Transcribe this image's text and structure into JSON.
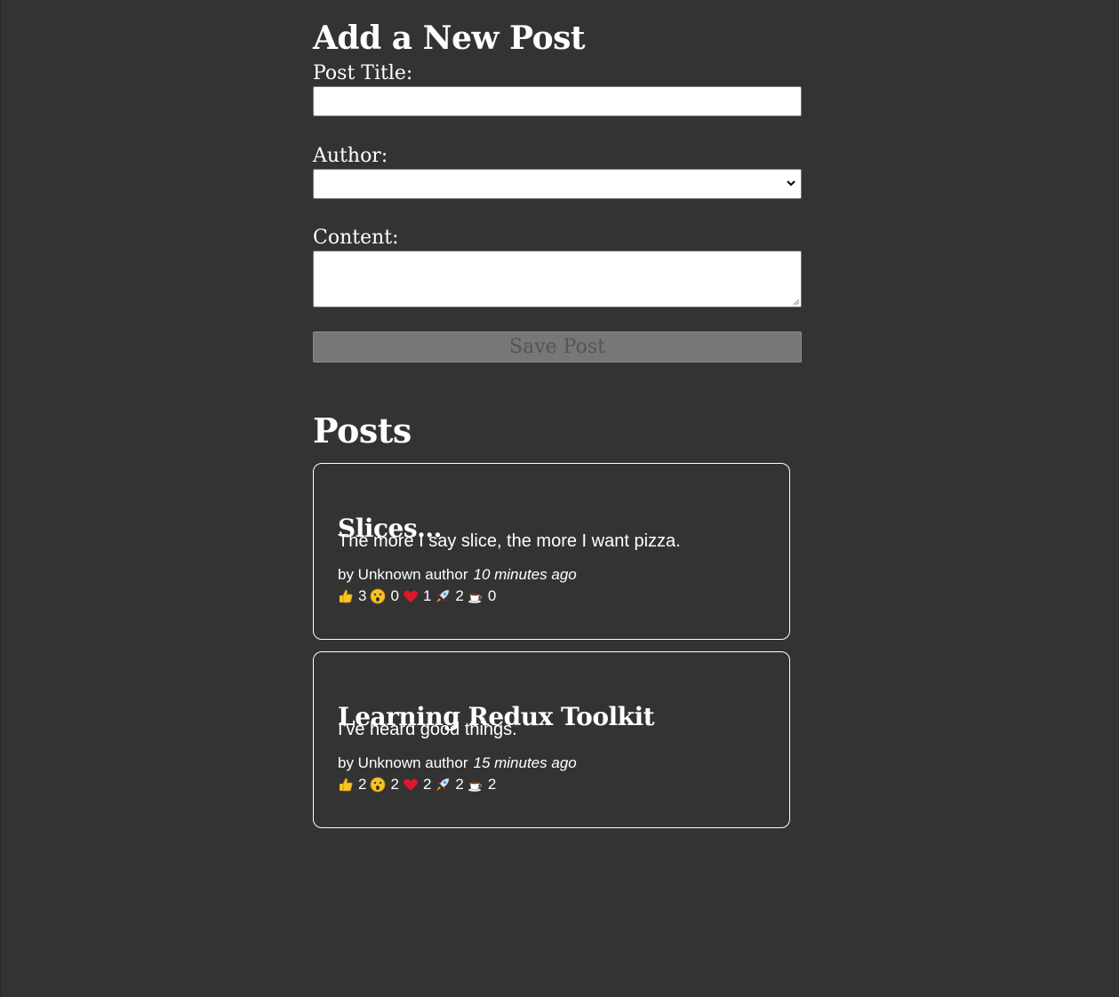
{
  "form": {
    "heading": "Add a New Post",
    "title_label": "Post Title:",
    "title_value": "",
    "author_label": "Author:",
    "author_value": "",
    "content_label": "Content:",
    "content_value": "",
    "save_label": "Save Post"
  },
  "posts_heading": "Posts",
  "posts": [
    {
      "title": "Slices...",
      "content": "The more I say slice, the more I want pizza.",
      "author": "by Unknown author",
      "time": "10 minutes ago",
      "reactions": [
        {
          "icon": "thumbs-up-icon",
          "count": "3"
        },
        {
          "icon": "wow-face-icon",
          "count": "0"
        },
        {
          "icon": "heart-icon",
          "count": "1"
        },
        {
          "icon": "rocket-icon",
          "count": "2"
        },
        {
          "icon": "coffee-icon",
          "count": "0"
        }
      ]
    },
    {
      "title": "Learning Redux Toolkit",
      "content": "I've heard good things.",
      "author": "by Unknown author",
      "time": "15 minutes ago",
      "reactions": [
        {
          "icon": "thumbs-up-icon",
          "count": "2"
        },
        {
          "icon": "wow-face-icon",
          "count": "2"
        },
        {
          "icon": "heart-icon",
          "count": "2"
        },
        {
          "icon": "rocket-icon",
          "count": "2"
        },
        {
          "icon": "coffee-icon",
          "count": "2"
        }
      ]
    }
  ],
  "colors": {
    "background": "#333333",
    "text": "#ffffff",
    "button_disabled": "#777777",
    "heart": "#e0162b",
    "emoji_yellow": "#f7c325"
  }
}
